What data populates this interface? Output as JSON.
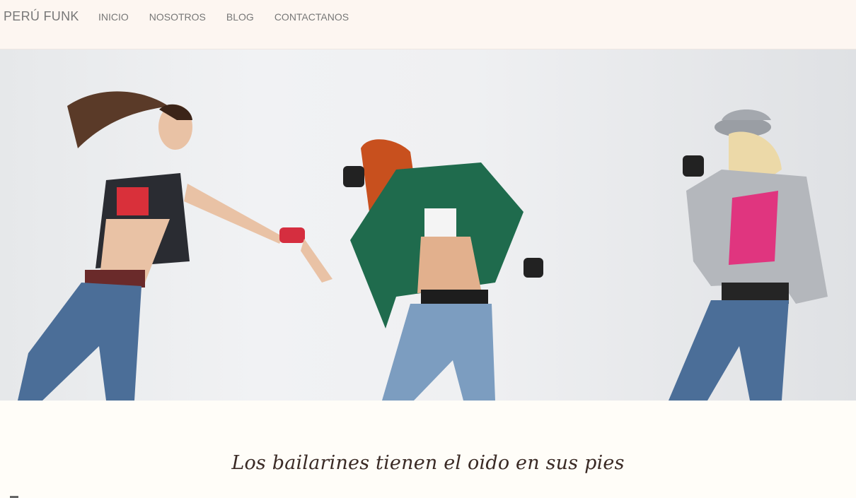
{
  "navbar": {
    "brand": "PERÚ FUNK",
    "links": [
      "INICIO",
      "NOSOTROS",
      "BLOG",
      "CONTACTANOS"
    ]
  },
  "hero": {
    "image_alt": "three street dancers",
    "colors": {
      "background": "#eceef0",
      "denim": "#4a6f96",
      "leather": "#2b2d33",
      "green_jacket": "#1f6b4d",
      "pink": "#e0357f"
    }
  },
  "tagline": "Los bailarines tienen el oido en sus pies"
}
